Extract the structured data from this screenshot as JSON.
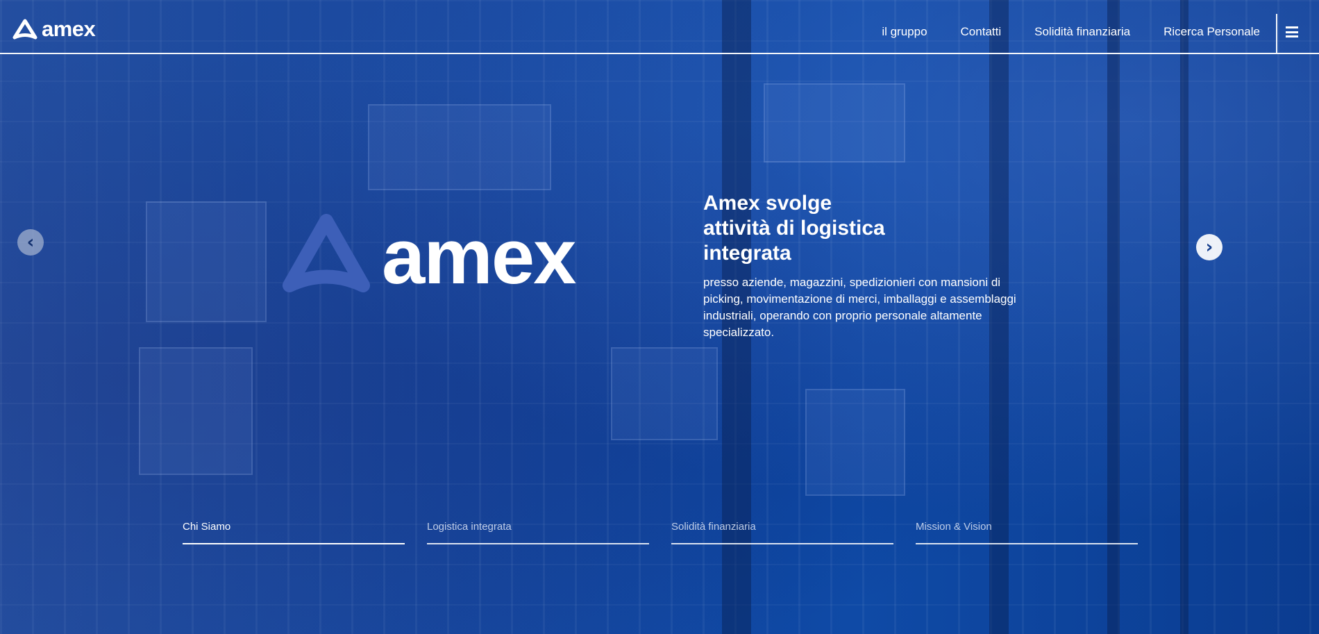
{
  "brand": {
    "name": "amex"
  },
  "nav": {
    "items": [
      "il gruppo",
      "Contatti",
      "Solidità finanziaria",
      "Ricerca Personale"
    ]
  },
  "hero": {
    "headline_lines": [
      "Amex svolge",
      "attività di logistica",
      "integrata"
    ],
    "description": "presso aziende, magazzini, spedizionieri con mansioni di picking, movimentazione di merci, imballaggi e assemblaggi industriali, operando con proprio personale altamente specializzato."
  },
  "slider": {
    "prev_icon": "chevron-left-icon",
    "next_icon": "chevron-right-icon",
    "tabs": [
      {
        "label": "Chi Siamo",
        "active": true
      },
      {
        "label": "Logistica integrata",
        "active": false
      },
      {
        "label": "Solidità finanziaria",
        "active": false
      },
      {
        "label": "Mission & Vision",
        "active": false
      }
    ]
  },
  "colors": {
    "background": "#0d3f98",
    "logo_triangle": "#3d5fb8",
    "text": "#ffffff"
  }
}
